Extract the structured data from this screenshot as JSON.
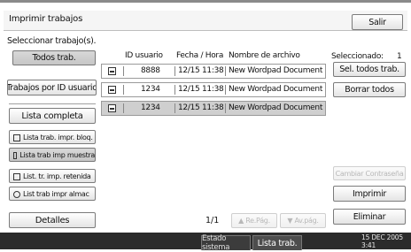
{
  "window": {
    "title": "Imprimir trabajos",
    "exit_label": "Salir"
  },
  "instruction": "Seleccionar trabajo(s).",
  "left_buttons": {
    "all_jobs": "Todos trab.",
    "jobs_by_user": "Trabajos por ID usuario",
    "full_list": "Lista completa",
    "locked_list": "Lista trab. impr. bloq.",
    "sample_list": "Lista trab imp muestra",
    "held_list": "List. tr. imp. retenida",
    "stored_list": "List trab impr almac",
    "details": "Detalles"
  },
  "table": {
    "headers": {
      "user_id": "ID usuario",
      "date_time": "Fecha / Hora",
      "file_name": "Nombre de archivo"
    },
    "rows": [
      {
        "user_id": "8888",
        "date_time": "12/15 11:38",
        "file_name": "New Wordpad Document",
        "selected": false
      },
      {
        "user_id": "1234",
        "date_time": "12/15 11:38",
        "file_name": "New Wordpad Document",
        "selected": false
      },
      {
        "user_id": "1234",
        "date_time": "12/15 11:38",
        "file_name": "New Wordpad Document",
        "selected": true
      }
    ]
  },
  "pagination": {
    "page": "1/1",
    "prev_label": "▲ Re.Pág.",
    "next_label": "▼ Av.pág."
  },
  "right_panel": {
    "selected_label": "Seleccionado:",
    "selected_count": "1",
    "select_all": "Sel. todos trab.",
    "clear_all": "Borrar todos",
    "change_password": "Cambiar Contraseña",
    "print": "Imprimir",
    "delete": "Eliminar"
  },
  "status_bar": {
    "system_status": "Estado sistema",
    "job_list": "Lista trab.",
    "date": "15 DEC  2005",
    "time": "3:41"
  }
}
